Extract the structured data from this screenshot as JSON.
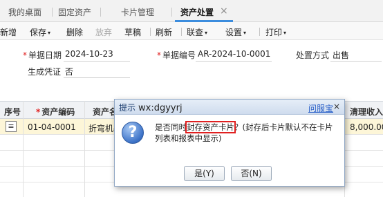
{
  "tabs": [
    {
      "label": "我的桌面"
    },
    {
      "label": "固定资产"
    },
    {
      "label": "卡片管理"
    },
    {
      "label": "资产处置",
      "active": true
    }
  ],
  "tab_close_icon": "×",
  "toolbar": {
    "add": "新增",
    "save": "保存",
    "delete": "删除",
    "abandon": "放弃",
    "draft": "草稿",
    "refresh": "刷新",
    "linked": "联查",
    "settings": "设置",
    "print": "打印",
    "caret": "▾"
  },
  "form": {
    "date_label": "单据日期",
    "date_value": "2024-10-23",
    "number_label": "单据编号",
    "number_value": "AR-2024-10-0001",
    "method_label": "处置方式",
    "method_value": "出售",
    "voucher_label": "生成凭证",
    "voucher_value": "否"
  },
  "table": {
    "headers": {
      "seq": "序号",
      "code": "资产编码",
      "name": "资产名",
      "clearing": "清理收入"
    },
    "row1": {
      "icon": "≡",
      "code": "01-04-0001",
      "name": "折弯机器",
      "clearing": "8,000.00"
    }
  },
  "dialog": {
    "title": "提示",
    "title_watermark": "wx:dgyyrj",
    "help": "问服宝",
    "close": "×",
    "icon": "?",
    "msg_before": "是否同时",
    "msg_highlight": "封存资产卡片",
    "msg_after": "？(封存后卡片默认不在卡片列表和报表中显示)",
    "yes": "是(Y)",
    "no": "否(N)"
  },
  "colors": {
    "accent": "#3c8dde",
    "required": "#e02020",
    "selected_row": "#fdf6d8",
    "link": "#2b61c9"
  }
}
